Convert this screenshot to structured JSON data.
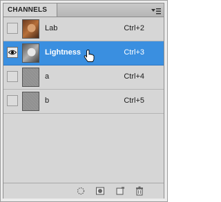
{
  "panel": {
    "tab_label": "CHANNELS",
    "menu_icon": "panel-menu-icon"
  },
  "channels": [
    {
      "name": "Lab",
      "shortcut": "Ctrl+2",
      "visible": false,
      "selected": false,
      "thumbnail": "color-portrait"
    },
    {
      "name": "Lightness",
      "shortcut": "Ctrl+3",
      "visible": true,
      "selected": true,
      "thumbnail": "grayscale-portrait"
    },
    {
      "name": "a",
      "shortcut": "Ctrl+4",
      "visible": false,
      "selected": false,
      "thumbnail": "gray-flat"
    },
    {
      "name": "b",
      "shortcut": "Ctrl+5",
      "visible": false,
      "selected": false,
      "thumbnail": "gray-flat"
    }
  ],
  "footer": {
    "buttons": [
      "load-selection-icon",
      "save-selection-icon",
      "new-channel-icon",
      "trash-icon"
    ]
  },
  "colors": {
    "selection": "#3a8fe0",
    "panel_bg": "#d6d6d6"
  }
}
